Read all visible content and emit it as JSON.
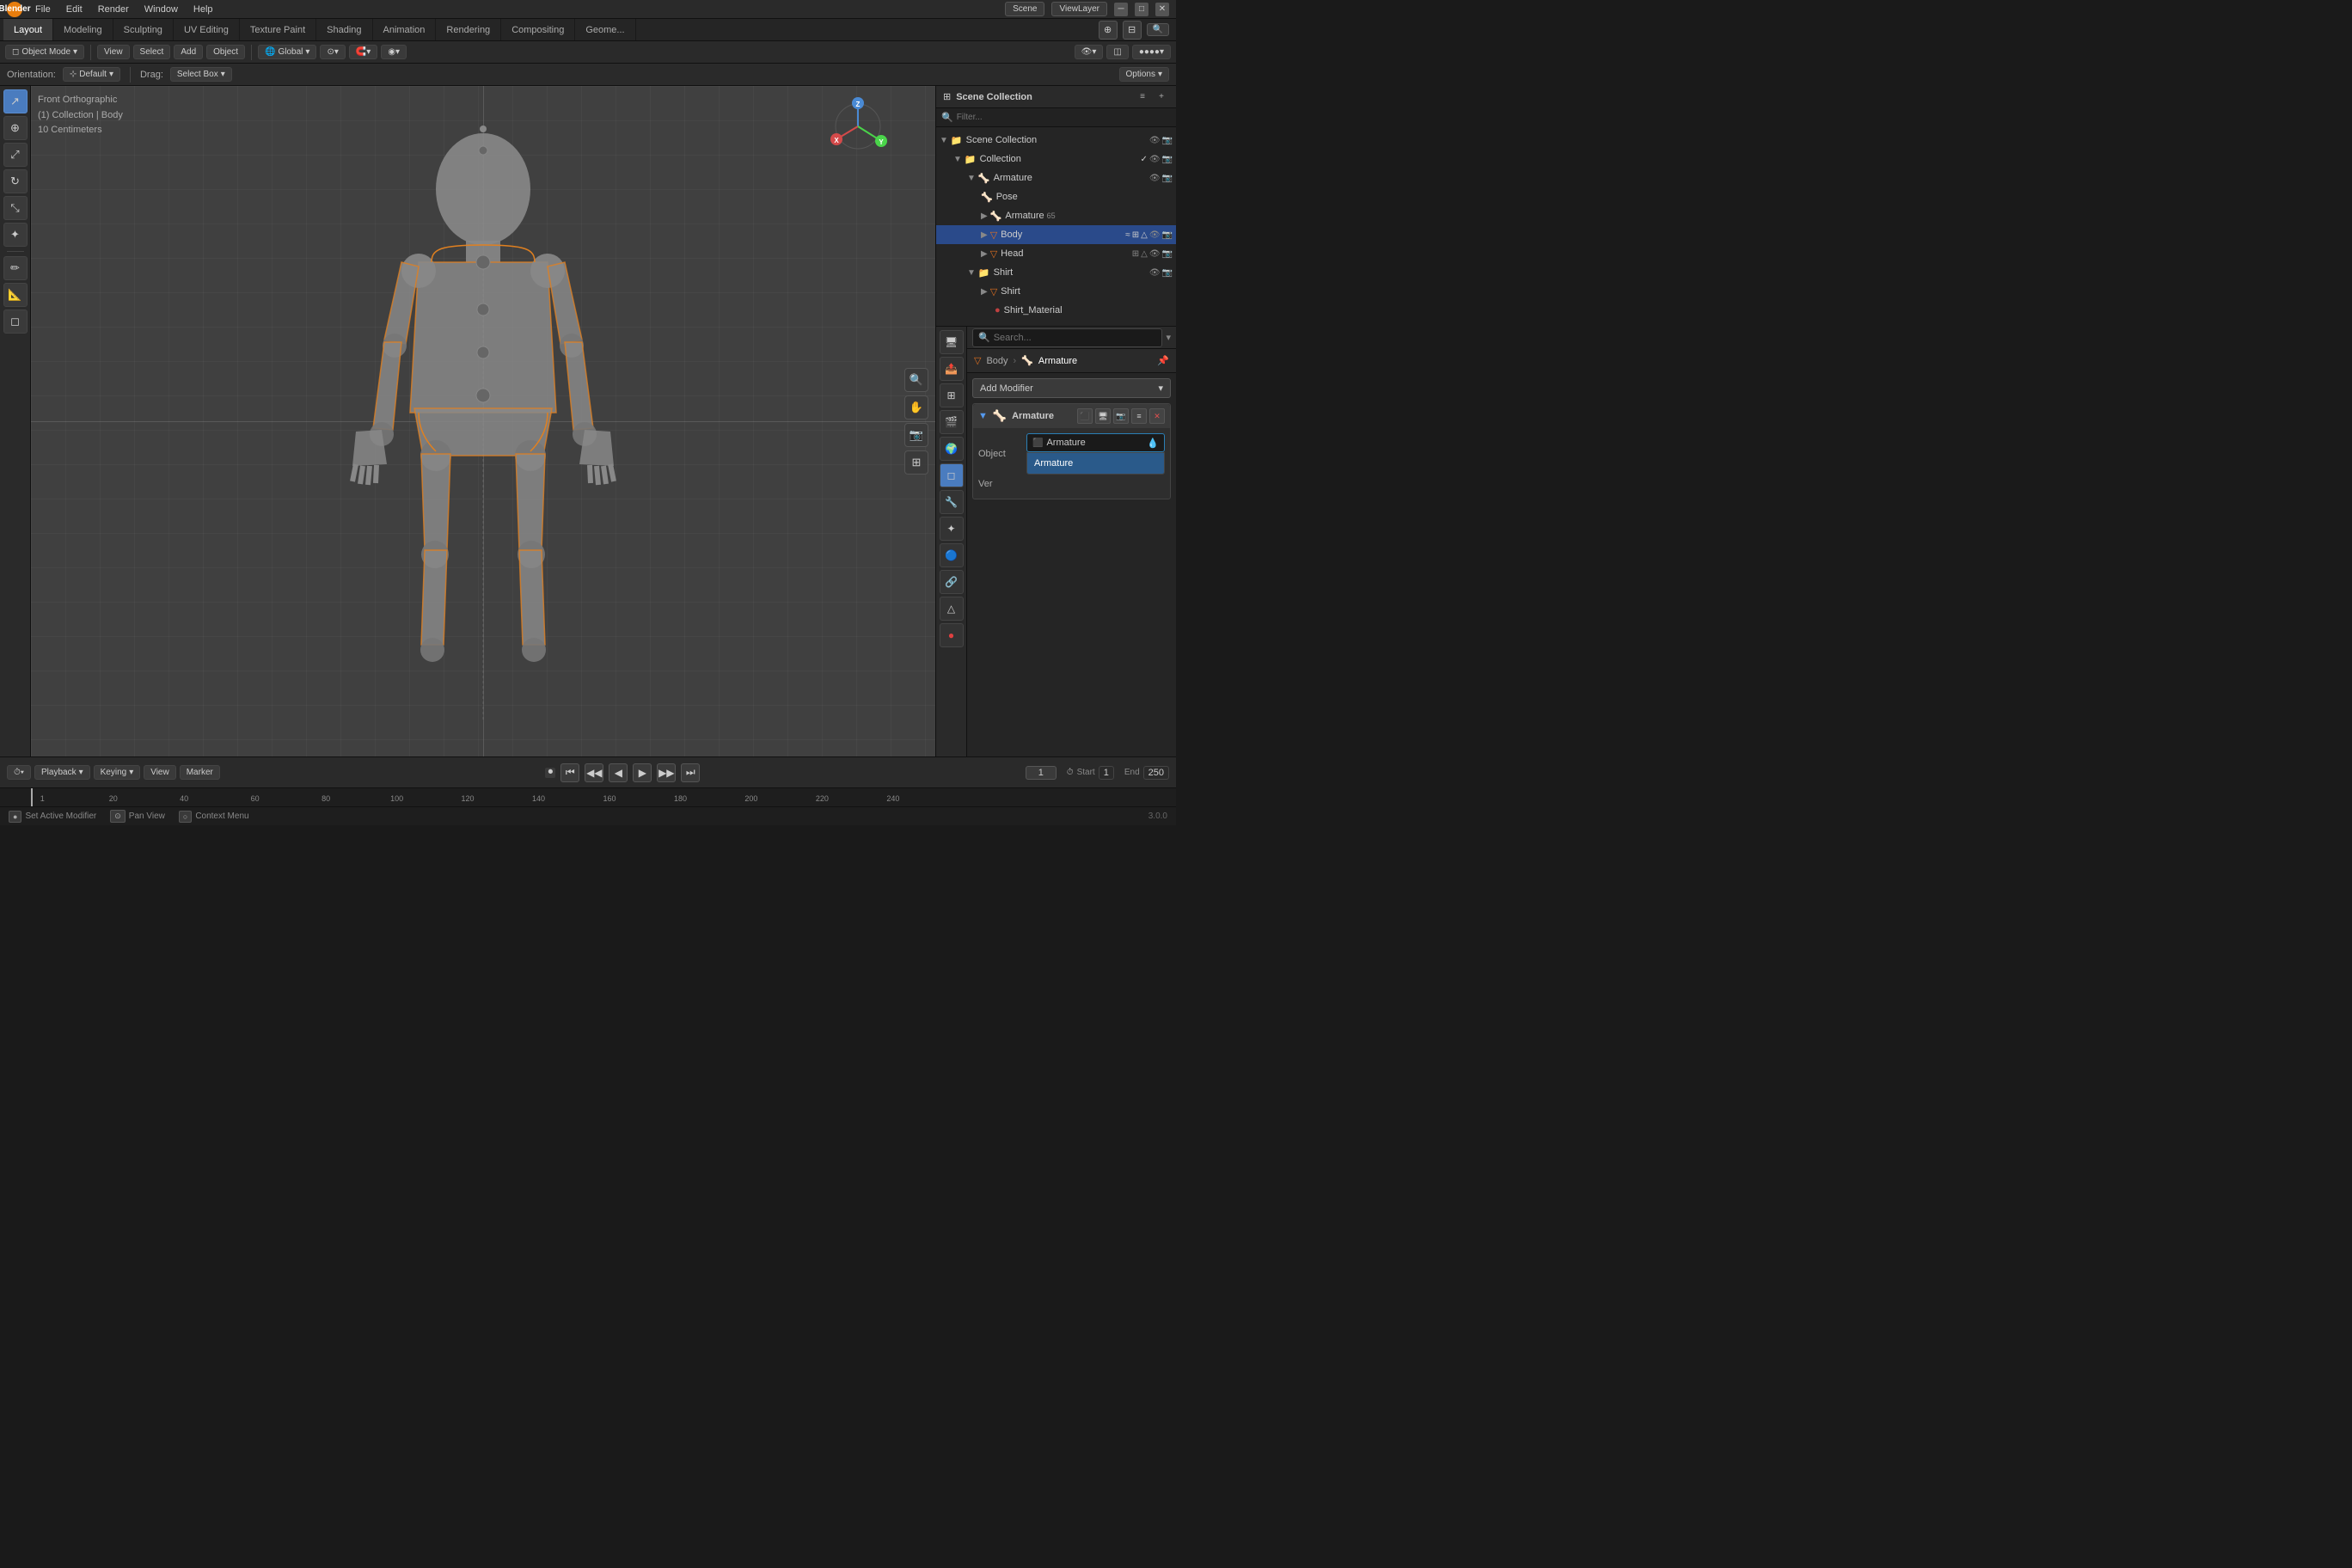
{
  "app": {
    "title": "Blender",
    "version": "3.0.0"
  },
  "top_menu": {
    "logo": "B",
    "items": [
      "File",
      "Edit",
      "Render",
      "Window",
      "Help"
    ]
  },
  "workspace_tabs": {
    "items": [
      "Layout",
      "Modeling",
      "Sculpting",
      "UV Editing",
      "Texture Paint",
      "Shading",
      "Animation",
      "Rendering",
      "Compositing",
      "Geome..."
    ],
    "active": "Layout",
    "scene_label": "Scene",
    "view_layer_label": "ViewLayer"
  },
  "second_toolbar": {
    "mode_btn": "Object Mode",
    "view_btn": "View",
    "select_btn": "Select",
    "add_btn": "Add",
    "object_btn": "Object",
    "transform_btn": "Global",
    "pivot_btn": ""
  },
  "third_toolbar": {
    "orientation_label": "Orientation:",
    "orientation_value": "Default",
    "drag_label": "Drag:",
    "drag_value": "Select Box",
    "options_btn": "Options"
  },
  "viewport": {
    "info_line1": "Front Orthographic",
    "info_line2": "(1) Collection | Body",
    "info_line3": "10 Centimeters",
    "gizmo": {
      "x_label": "X",
      "y_label": "Y",
      "z_label": "Z"
    }
  },
  "outliner": {
    "title": "Scene Collection",
    "items": [
      {
        "id": "scene-collection",
        "label": "Scene Collection",
        "level": 0,
        "icon": "📁",
        "arrow": "▼"
      },
      {
        "id": "collection",
        "label": "Collection",
        "level": 1,
        "icon": "📁",
        "arrow": "▼",
        "checked": true
      },
      {
        "id": "armature-root",
        "label": "Armature",
        "level": 2,
        "icon": "🦴",
        "arrow": "▼"
      },
      {
        "id": "pose",
        "label": "Pose",
        "level": 3,
        "icon": "🦴",
        "arrow": ""
      },
      {
        "id": "armature-sub",
        "label": "Armature",
        "level": 3,
        "icon": "🦴",
        "arrow": "▶",
        "badge": "65"
      },
      {
        "id": "body",
        "label": "Body",
        "level": 3,
        "icon": "▽",
        "arrow": "▶",
        "selected": true,
        "active": true
      },
      {
        "id": "head",
        "label": "Head",
        "level": 3,
        "icon": "▽",
        "arrow": "▶"
      },
      {
        "id": "shirt-root",
        "label": "Shirt",
        "level": 2,
        "icon": "📁",
        "arrow": "▼"
      },
      {
        "id": "shirt-obj",
        "label": "Shirt",
        "level": 3,
        "icon": "▽",
        "arrow": "▶"
      },
      {
        "id": "shirt-mat",
        "label": "Shirt_Material",
        "level": 4,
        "icon": "●",
        "arrow": ""
      }
    ]
  },
  "properties": {
    "breadcrumb": [
      "Body",
      ">",
      "Armature"
    ],
    "search_placeholder": "Search...",
    "add_modifier_label": "Add Modifier",
    "modifier": {
      "name": "Armature",
      "object_label": "Object",
      "object_value": "Armature",
      "vertex_label": "Ver",
      "icons": [
        "⬛",
        "🖥",
        "📷",
        "≡"
      ]
    },
    "autocomplete": {
      "items": [
        "Armature"
      ],
      "selected": "Armature"
    }
  },
  "timeline": {
    "playback_label": "Playback",
    "keying_label": "Keying",
    "view_label": "View",
    "marker_label": "Marker",
    "current_frame": "1",
    "start_label": "Start",
    "start_value": "1",
    "end_label": "End",
    "end_value": "250",
    "ruler_marks": [
      "1",
      "20",
      "40",
      "60",
      "80",
      "100",
      "120",
      "140",
      "160",
      "180",
      "200",
      "220",
      "240"
    ]
  },
  "status_bar": {
    "left_label": "Set Active Modifier",
    "middle_label": "Pan View",
    "right_label": "Context Menu",
    "version": "3.0.0"
  },
  "left_toolbar": {
    "tools": [
      {
        "id": "select",
        "icon": "↗",
        "active": true
      },
      {
        "id": "cursor",
        "icon": "⊕"
      },
      {
        "id": "move",
        "icon": "⤢"
      },
      {
        "id": "rotate",
        "icon": "↻"
      },
      {
        "id": "scale",
        "icon": "⤡"
      },
      {
        "id": "transform",
        "icon": "✦"
      },
      {
        "id": "annotate",
        "icon": "✏"
      },
      {
        "id": "measure",
        "icon": "📐"
      },
      {
        "id": "add-cube",
        "icon": "◻"
      }
    ]
  }
}
